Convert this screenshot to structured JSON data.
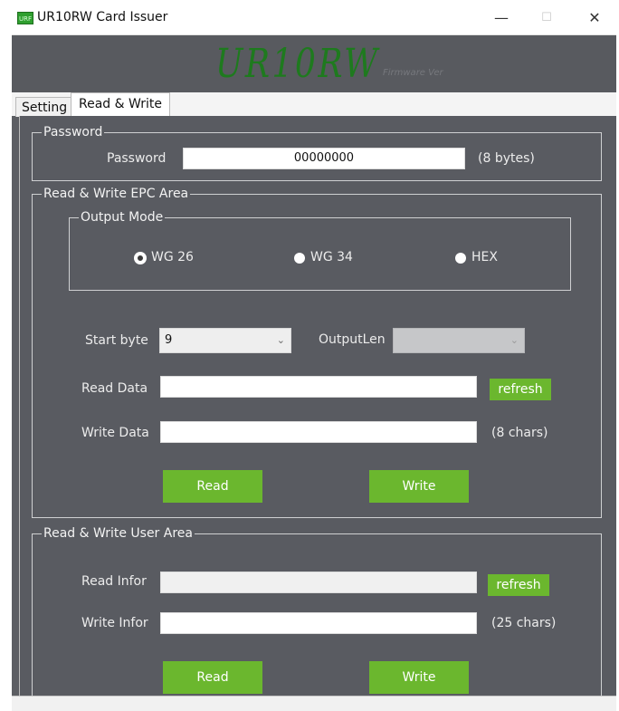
{
  "window": {
    "title": "UR10RW Card Issuer",
    "icon_text": "URF",
    "controls": {
      "minimize": "—",
      "maximize": "☐",
      "close": "✕"
    }
  },
  "banner": {
    "logo": "UR10RW",
    "firmware_label": "Firmware Ver"
  },
  "tabs": [
    {
      "label": "Setting",
      "active": false
    },
    {
      "label": "Read & Write",
      "active": true
    }
  ],
  "password_group": {
    "title": "Password",
    "label": "Password",
    "value": "00000000",
    "hint": "(8 bytes)"
  },
  "epc_group": {
    "title": "Read & Write EPC Area",
    "output_mode": {
      "title": "Output Mode",
      "options": [
        {
          "label": "WG 26",
          "selected": true
        },
        {
          "label": "WG 34",
          "selected": false
        },
        {
          "label": "HEX",
          "selected": false
        }
      ]
    },
    "start_byte": {
      "label": "Start byte",
      "value": "9"
    },
    "output_len": {
      "label": "OutputLen",
      "value": ""
    },
    "read_data": {
      "label": "Read Data",
      "value": "",
      "refresh": "refresh"
    },
    "write_data": {
      "label": "Write Data",
      "value": "",
      "hint": "(8 chars)"
    },
    "read_button": "Read",
    "write_button": "Write"
  },
  "user_group": {
    "title": "Read & Write User Area",
    "read_infor": {
      "label": "Read Infor",
      "value": "",
      "refresh": "refresh"
    },
    "write_infor": {
      "label": "Write Infor",
      "value": "",
      "hint": "(25 chars)"
    },
    "read_button": "Read",
    "write_button": "Write"
  },
  "colors": {
    "accent_green": "#6bb72e",
    "logo_green": "#1e7a1e",
    "panel_bg": "#595b61"
  }
}
